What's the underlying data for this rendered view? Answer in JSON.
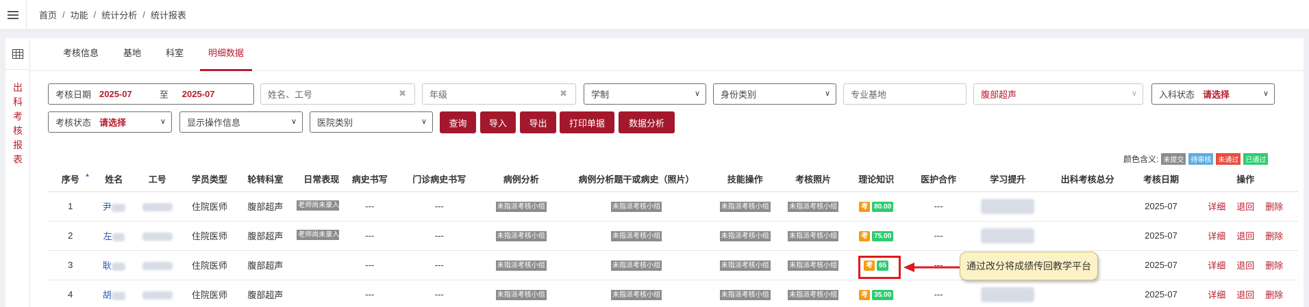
{
  "breadcrumb": [
    "首页",
    "功能",
    "统计分析",
    "统计报表"
  ],
  "sidebar": {
    "vertical_title": [
      "出",
      "科",
      "考",
      "核",
      "报",
      "表"
    ]
  },
  "tabs": [
    {
      "label": "考核信息",
      "active": false
    },
    {
      "label": "基地",
      "active": false
    },
    {
      "label": "科室",
      "active": false
    },
    {
      "label": "明细数据",
      "active": true
    }
  ],
  "filters": {
    "date_label": "考核日期",
    "date_from": "2025-07",
    "date_to_sep": "至",
    "date_to": "2025-07",
    "name_placeholder": "姓名、工号",
    "grade_placeholder": "年级",
    "system_placeholder": "学制",
    "identity_placeholder": "身份类别",
    "base_placeholder": "专业基地",
    "dept_value": "腹部超声",
    "enroll_label": "入科状态",
    "enroll_value": "请选择",
    "exam_label": "考核状态",
    "exam_value": "请选择",
    "display_op": "显示操作信息",
    "hospital_type": "医院类别"
  },
  "buttons": {
    "query": "查询",
    "import": "导入",
    "export": "导出",
    "print": "打印单据",
    "analysis": "数据分析"
  },
  "legend": {
    "label": "颜色含义:",
    "items": [
      {
        "text": "未提交",
        "color": "#8c8c8c"
      },
      {
        "text": "待审核",
        "color": "#5dade2"
      },
      {
        "text": "未通过",
        "color": "#e74c3c"
      },
      {
        "text": "已通过",
        "color": "#2ecc71"
      }
    ]
  },
  "table": {
    "headers": [
      "序号",
      "姓名",
      "工号",
      "学员类型",
      "轮转科室",
      "日常表现",
      "病史书写",
      "门诊病史书写",
      "病例分析",
      "病例分析题干或病史（照片）",
      "技能操作",
      "考核照片",
      "理论知识",
      "医护合作",
      "学习提升",
      "出科考核总分",
      "考核日期",
      "操作"
    ],
    "header_visible": [
      "序号",
      "姓名",
      "工号",
      "学员类型",
      "轮转科室",
      "日常表现",
      "病史书写",
      "门诊病史书写",
      "病例分析",
      "病例分析题干或病史（照片）",
      "技能操作",
      "考核照片",
      "理论知识",
      "医护合作",
      "学习提升",
      "出科考核总分",
      "考核日期",
      "操作"
    ],
    "rows": [
      {
        "no": "1",
        "name": "尹",
        "type": "住院医师",
        "dept": "腹部超声",
        "daily": "老师尚未录入",
        "history": "---",
        "outpatient": "---",
        "case": "未指派考核小组",
        "case_photo": "未指派考核小组",
        "skill": "未指派考核小组",
        "photo": "未指派考核小组",
        "kao": "考",
        "score": "80.00",
        "nursing": "---",
        "date": "2025-07"
      },
      {
        "no": "2",
        "name": "左",
        "type": "住院医师",
        "dept": "腹部超声",
        "daily": "老师尚未录入",
        "history": "---",
        "outpatient": "---",
        "case": "未指派考核小组",
        "case_photo": "未指派考核小组",
        "skill": "未指派考核小组",
        "photo": "未指派考核小组",
        "kao": "考",
        "score": "75.00",
        "nursing": "---",
        "date": "2025-07"
      },
      {
        "no": "3",
        "name": "耿",
        "type": "住院医师",
        "dept": "腹部超声",
        "daily": "",
        "history": "---",
        "outpatient": "---",
        "case": "未指派考核小组",
        "case_photo": "未指派考核小组",
        "skill": "未指派考核小组",
        "photo": "未指派考核小组",
        "kao": "考",
        "score": "65",
        "nursing": "---",
        "date": "2025-07"
      },
      {
        "no": "4",
        "name": "胡",
        "type": "住院医师",
        "dept": "腹部超声",
        "daily": "",
        "history": "---",
        "outpatient": "---",
        "case": "未指派考核小组",
        "case_photo": "未指派考核小组",
        "skill": "未指派考核小组",
        "photo": "未指派考核小组",
        "kao": "考",
        "score": "35.00",
        "nursing": "---",
        "date": "2025-07"
      }
    ],
    "actions": [
      "详细",
      "退回",
      "删除"
    ]
  },
  "callout": "通过改分将成绩传回教学平台"
}
